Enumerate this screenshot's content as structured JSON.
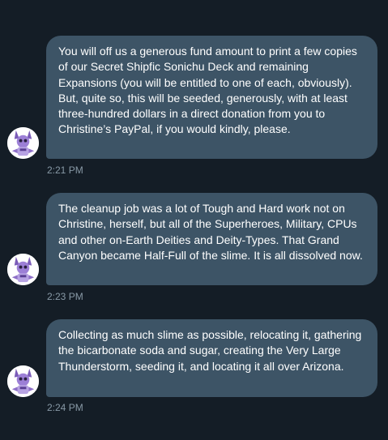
{
  "conversation": {
    "messages": [
      {
        "text": "You will off us a generous fund amount to print a few copies of our Secret Shipfic Sonichu Deck and remaining Expansions (you will be entitled to one of each, obviously).  But, quite so, this will be seeded, generously, with at least three-hundred dollars in a direct donation from you to Christine’s PayPal, if you would kindly, please.",
        "time": "2:21 PM"
      },
      {
        "text": "The cleanup job was a lot of Tough and Hard work not on Christine, herself, but all of the Superheroes, Military, CPUs and other on-Earth Deities and Deity-Types.  That Grand Canyon became Half-Full of the slime.  It is all dissolved now.",
        "time": "2:23 PM"
      },
      {
        "text": "Collecting as much slime as possible, relocating it, gathering the bicarbonate soda and sugar, creating the Very Large Thunderstorm, seeding it, and locating it all over Arizona.",
        "time": "2:24 PM"
      }
    ]
  },
  "colors": {
    "background": "#141d26",
    "bubble": "#3d5466",
    "text": "#ffffff",
    "timestamp": "#8899a6"
  },
  "icons": {
    "avatar": "purple-cartoon-character-avatar"
  }
}
